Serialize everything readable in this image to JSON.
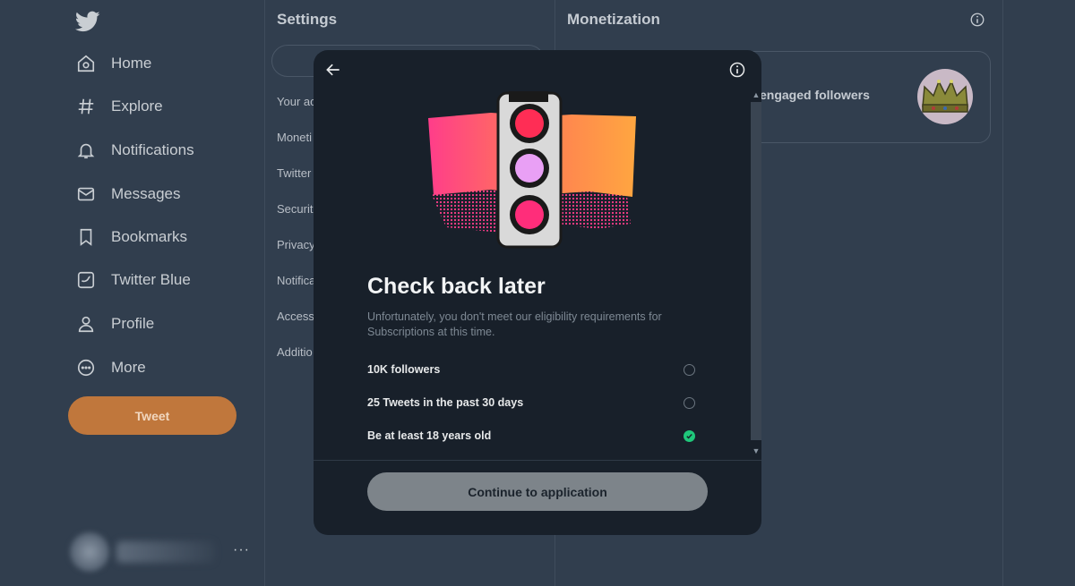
{
  "sidebar": {
    "logo": "twitter-bird-icon",
    "items": [
      {
        "label": "Home",
        "icon": "home-icon"
      },
      {
        "label": "Explore",
        "icon": "hashtag-icon"
      },
      {
        "label": "Notifications",
        "icon": "bell-icon"
      },
      {
        "label": "Messages",
        "icon": "envelope-icon"
      },
      {
        "label": "Bookmarks",
        "icon": "bookmark-icon"
      },
      {
        "label": "Twitter Blue",
        "icon": "twitter-blue-icon"
      },
      {
        "label": "Profile",
        "icon": "person-icon"
      },
      {
        "label": "More",
        "icon": "more-circle-icon"
      }
    ],
    "tweet_label": "Tweet",
    "account_more": "···"
  },
  "settings": {
    "title": "Settings",
    "items": [
      "Your ac",
      "Moneti",
      "Twitter",
      "Securit",
      "Privacy",
      "Notifica",
      "Access",
      "Additio"
    ]
  },
  "monetization": {
    "title": "Monetization",
    "card_text": "engaged followers"
  },
  "modal": {
    "heading": "Check back later",
    "subtitle": "Unfortunately, you don't meet our eligibility requirements for Subscriptions at this time.",
    "requirements": [
      {
        "label": "10K followers",
        "met": false
      },
      {
        "label": "25 Tweets in the past 30 days",
        "met": false
      },
      {
        "label": "Be at least 18 years old",
        "met": true
      }
    ],
    "continue_label": "Continue to application"
  },
  "colors": {
    "background": "#313e4e",
    "modal_bg": "#18202a",
    "tweet_button": "#c0773c",
    "check_green": "#1fc77a",
    "continue_button": "#7d848a"
  }
}
